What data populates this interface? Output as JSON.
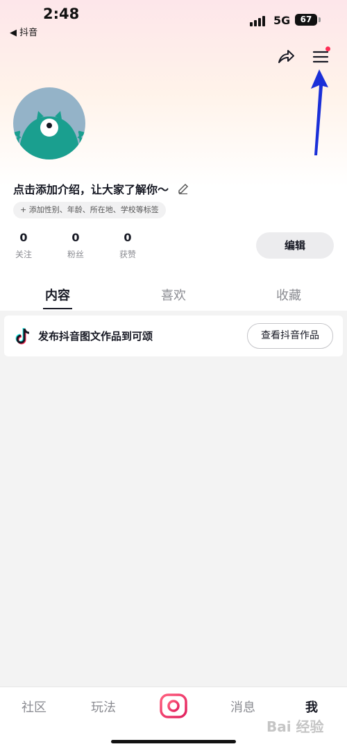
{
  "status_bar": {
    "time": "2:48",
    "back_app": "◀ 抖音",
    "network": "5G",
    "battery": "67"
  },
  "header": {
    "share_icon": "share-arrow-icon",
    "menu_icon": "hamburger-menu-icon"
  },
  "profile": {
    "bio": "点击添加介绍，让大家了解你～",
    "tag_chip": "+ 添加性别、年龄、所在地、学校等标签",
    "stats": [
      {
        "value": "0",
        "label": "关注"
      },
      {
        "value": "0",
        "label": "粉丝"
      },
      {
        "value": "0",
        "label": "获赞"
      }
    ],
    "edit_button": "编辑"
  },
  "tabs": [
    {
      "label": "内容"
    },
    {
      "label": "喜欢"
    },
    {
      "label": "收藏"
    }
  ],
  "promo": {
    "text": "发布抖音图文作品到可颂",
    "button": "查看抖音作品"
  },
  "bottom_nav": {
    "items": [
      {
        "label": "社区"
      },
      {
        "label": "玩法"
      },
      {
        "label": "消息"
      },
      {
        "label": "我"
      }
    ]
  },
  "watermark": "Bai 经验",
  "colors": {
    "accent": "#fe2c55",
    "annotation_arrow": "#1a2fd8"
  }
}
